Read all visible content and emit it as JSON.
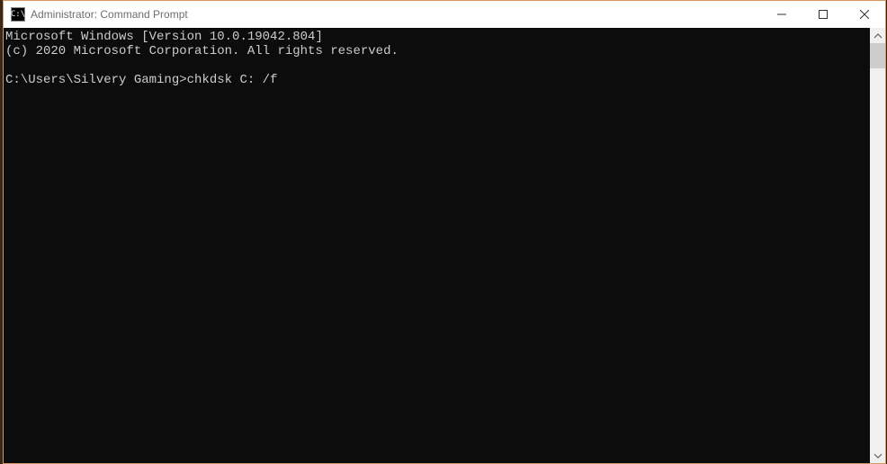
{
  "window": {
    "title": "Administrator: Command Prompt",
    "icon_text": "C:\\"
  },
  "terminal": {
    "line1": "Microsoft Windows [Version 10.0.19042.804]",
    "line2": "(c) 2020 Microsoft Corporation. All rights reserved.",
    "blank": "",
    "prompt": "C:\\Users\\Silvery Gaming>",
    "command": "chkdsk C: /f"
  }
}
